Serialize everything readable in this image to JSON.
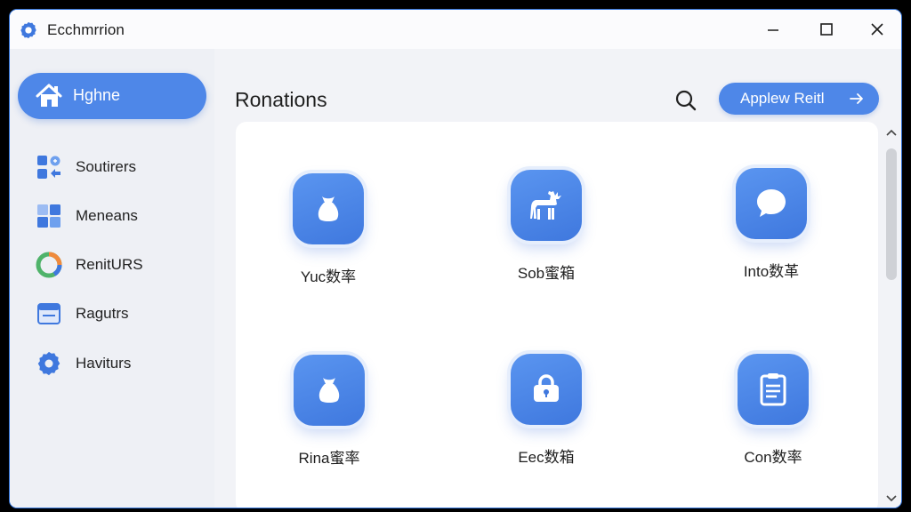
{
  "window": {
    "title": "Ecchmrrion",
    "app_icon": "gear-icon",
    "controls": [
      "minimize-icon",
      "maximize-icon",
      "close-icon"
    ]
  },
  "sidebar": {
    "active": {
      "label": "Hghne",
      "icon": "home-icon"
    },
    "items": [
      {
        "label": "Soutirers",
        "icon": "apps-icon"
      },
      {
        "label": "Meneans",
        "icon": "grid-icon"
      },
      {
        "label": "RenitURS",
        "icon": "pie-chart-icon"
      },
      {
        "label": "Ragutrs",
        "icon": "inbox-icon"
      },
      {
        "label": "Haviturs",
        "icon": "gear-icon"
      }
    ]
  },
  "main": {
    "title": "Ronations",
    "search_icon": "search-icon",
    "primary_button": {
      "label": "Applew Reitl",
      "icon": "arrow-right-icon"
    },
    "tiles": [
      {
        "label": "Yuc数率",
        "icon": "bag-icon"
      },
      {
        "label": "Sob蜜箱",
        "icon": "deer-icon"
      },
      {
        "label": "Into数革",
        "icon": "chat-bubble-icon"
      },
      {
        "label": "Rina蜜率",
        "icon": "bag-icon"
      },
      {
        "label": "Eec数箱",
        "icon": "lock-icon"
      },
      {
        "label": "Con数率",
        "icon": "clipboard-icon"
      }
    ]
  },
  "colors": {
    "accent": "#4e87e8",
    "window_border": "#2d6fd6",
    "sidebar_bg": "#eef0f5",
    "card_bg": "#ffffff"
  }
}
